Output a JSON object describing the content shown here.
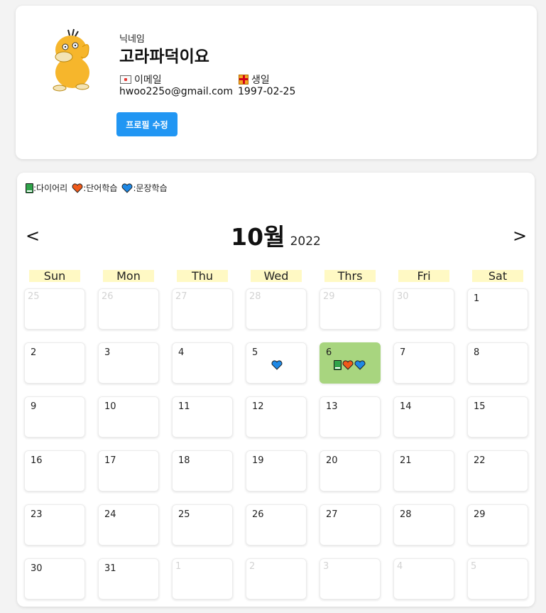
{
  "profile": {
    "nickname_label": "닉네임",
    "nickname": "고라파덕이요",
    "email_label": "이메일",
    "email": "hwoo225o@gmail.com",
    "birthday_label": "생일",
    "birthday": "1997-02-25",
    "edit_button": "프로필 수정",
    "avatar_icon": "psyduck-avatar",
    "email_icon": "mail-icon",
    "birthday_icon": "gift-icon"
  },
  "legend": {
    "diary": ":다이어리",
    "word": ":단어학습",
    "sentence": ":문장학습",
    "colors": {
      "diary": "#2fa34a",
      "word": "#f05a1a",
      "sentence": "#1e88e5"
    }
  },
  "calendar": {
    "month": "10월",
    "year": "2022",
    "prev_label": "<",
    "next_label": ">",
    "weekdays": [
      "Sun",
      "Mon",
      "Thu",
      "Wed",
      "Thrs",
      "Fri",
      "Sat"
    ],
    "weeks": [
      [
        {
          "d": "25",
          "other": true
        },
        {
          "d": "26",
          "other": true
        },
        {
          "d": "27",
          "other": true
        },
        {
          "d": "28",
          "other": true
        },
        {
          "d": "29",
          "other": true
        },
        {
          "d": "30",
          "other": true
        },
        {
          "d": "1"
        }
      ],
      [
        {
          "d": "2"
        },
        {
          "d": "3"
        },
        {
          "d": "4"
        },
        {
          "d": "5",
          "marks": [
            "sentence"
          ]
        },
        {
          "d": "6",
          "today": true,
          "marks": [
            "diary",
            "word",
            "sentence"
          ]
        },
        {
          "d": "7"
        },
        {
          "d": "8"
        }
      ],
      [
        {
          "d": "9"
        },
        {
          "d": "10"
        },
        {
          "d": "11"
        },
        {
          "d": "12"
        },
        {
          "d": "13"
        },
        {
          "d": "14"
        },
        {
          "d": "15"
        }
      ],
      [
        {
          "d": "16"
        },
        {
          "d": "17"
        },
        {
          "d": "18"
        },
        {
          "d": "19"
        },
        {
          "d": "20"
        },
        {
          "d": "21"
        },
        {
          "d": "22"
        }
      ],
      [
        {
          "d": "23"
        },
        {
          "d": "24"
        },
        {
          "d": "25"
        },
        {
          "d": "26"
        },
        {
          "d": "27"
        },
        {
          "d": "28"
        },
        {
          "d": "29"
        }
      ],
      [
        {
          "d": "30"
        },
        {
          "d": "31"
        },
        {
          "d": "1",
          "other": true
        },
        {
          "d": "2",
          "other": true
        },
        {
          "d": "3",
          "other": true
        },
        {
          "d": "4",
          "other": true
        },
        {
          "d": "5",
          "other": true
        }
      ]
    ],
    "today_color": "#a8d57f",
    "weekday_bg": "#fff9c4",
    "accent": "#2196f3"
  }
}
